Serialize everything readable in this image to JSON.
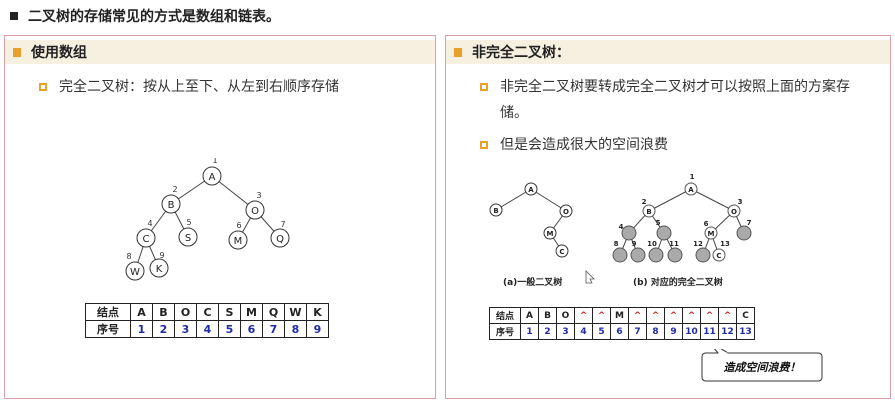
{
  "slide": {
    "title": "二叉树的存储常见的方式是数组和链表。"
  },
  "left": {
    "heading": "使用数组",
    "bullet": "完全二叉树：按从上至下、从左到右顺序存储",
    "tree": {
      "nodes": [
        {
          "label": "A",
          "index": "1"
        },
        {
          "label": "B",
          "index": "2"
        },
        {
          "label": "O",
          "index": "3"
        },
        {
          "label": "C",
          "index": "4"
        },
        {
          "label": "S",
          "index": "5"
        },
        {
          "label": "M",
          "index": "6"
        },
        {
          "label": "Q",
          "index": "7"
        },
        {
          "label": "W",
          "index": "8"
        },
        {
          "label": "K",
          "index": "9"
        }
      ]
    },
    "table": {
      "row1_head": "结点",
      "row1": [
        "A",
        "B",
        "O",
        "C",
        "S",
        "M",
        "Q",
        "W",
        "K"
      ],
      "row2_head": "序号",
      "row2": [
        "1",
        "2",
        "3",
        "4",
        "5",
        "6",
        "7",
        "8",
        "9"
      ]
    }
  },
  "right": {
    "heading": "非完全二叉树：",
    "bullet1": "非完全二叉树要转成完全二叉树才可以按照上面的方案存储。",
    "bullet1_line1": "非完全二叉树要转成完全二叉树才可以按照上面的方案存",
    "bullet1_line2": "储。",
    "bullet2": "但是会造成很大的空间浪费",
    "caption_a": "(a)一般二叉树",
    "caption_b": "(b) 对应的完全二叉树",
    "tree_a": {
      "nodes": [
        "A",
        "B",
        "O",
        "M",
        "C"
      ]
    },
    "tree_b": {
      "labels": [
        "A",
        "B",
        "O",
        "M",
        "C"
      ],
      "indices": [
        "1",
        "2",
        "3",
        "4",
        "5",
        "6",
        "7",
        "8",
        "9",
        "10",
        "11",
        "12",
        "13"
      ]
    },
    "table": {
      "row1_head": "结点",
      "row1": [
        "A",
        "B",
        "O",
        "^",
        "^",
        "M",
        "^",
        "^",
        "^",
        "^",
        "^",
        "^",
        "C"
      ],
      "row2_head": "序号",
      "row2": [
        "1",
        "2",
        "3",
        "4",
        "5",
        "6",
        "7",
        "8",
        "9",
        "10",
        "11",
        "12",
        "13"
      ]
    },
    "callout": "造成空间浪费！"
  }
}
